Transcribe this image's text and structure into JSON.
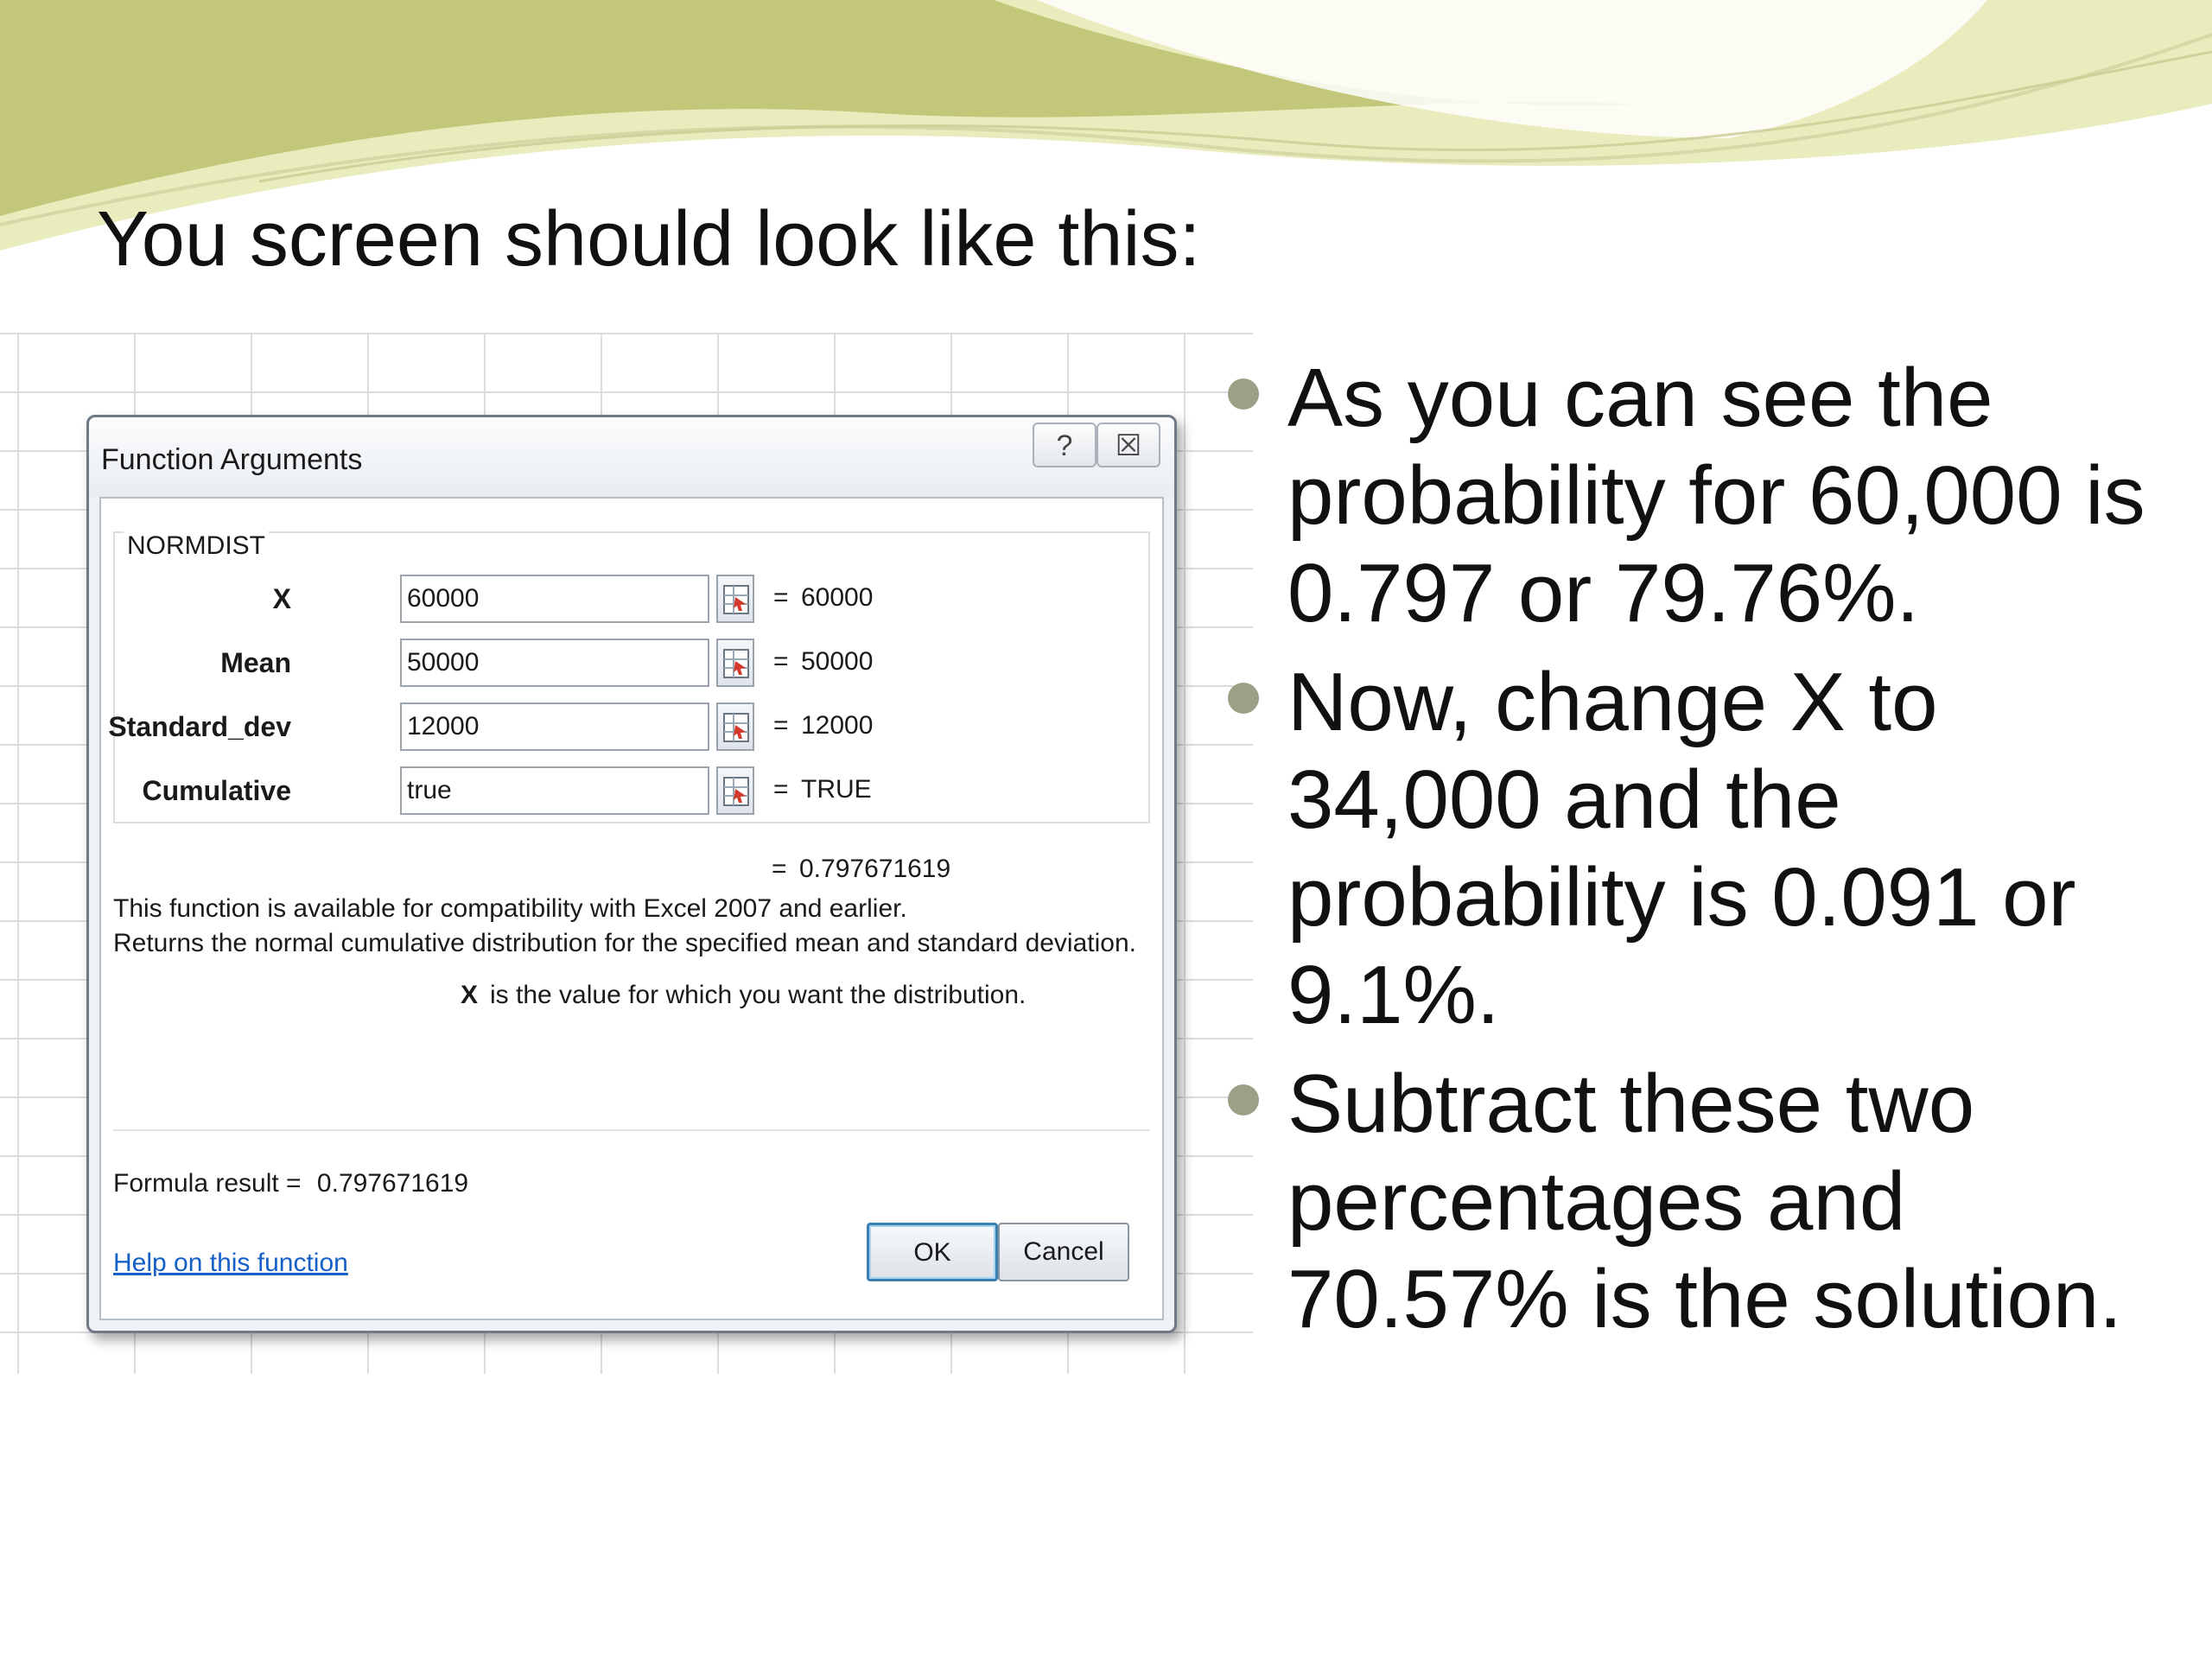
{
  "slide": {
    "title": "You screen should look like this:",
    "bullets": [
      "As you can see the probability for 60,000 is 0.797 or 79.76%.",
      "Now, change X to 34,000 and the probability is 0.091 or 9.1%.",
      "Subtract these two percentages and 70.57% is the solution."
    ],
    "colors": {
      "bullet": "#9da086",
      "wave_light": "#e9ecbd",
      "wave_dark": "#b9bf6a"
    }
  },
  "dialog": {
    "title": "Function Arguments",
    "help_button": "?",
    "close_button": "☒",
    "function_name": "NORMDIST",
    "arguments": [
      {
        "label": "X",
        "value": "60000",
        "result": "60000"
      },
      {
        "label": "Mean",
        "value": "50000",
        "result": "50000"
      },
      {
        "label": "Standard_dev",
        "value": "12000",
        "result": "12000"
      },
      {
        "label": "Cumulative",
        "value": "true",
        "result": "TRUE"
      }
    ],
    "equals": "=",
    "result": "0.797671619",
    "description_line1": "This function is available for compatibility with Excel 2007 and earlier.",
    "description_line2": "Returns the normal cumulative distribution for the specified mean and standard deviation.",
    "arg_help_name": "X",
    "arg_help_text": "is the value for which you want the distribution.",
    "formula_result_label": "Formula result =",
    "formula_result_value": "0.797671619",
    "help_link": "Help on this function",
    "ok_label": "OK",
    "cancel_label": "Cancel"
  }
}
